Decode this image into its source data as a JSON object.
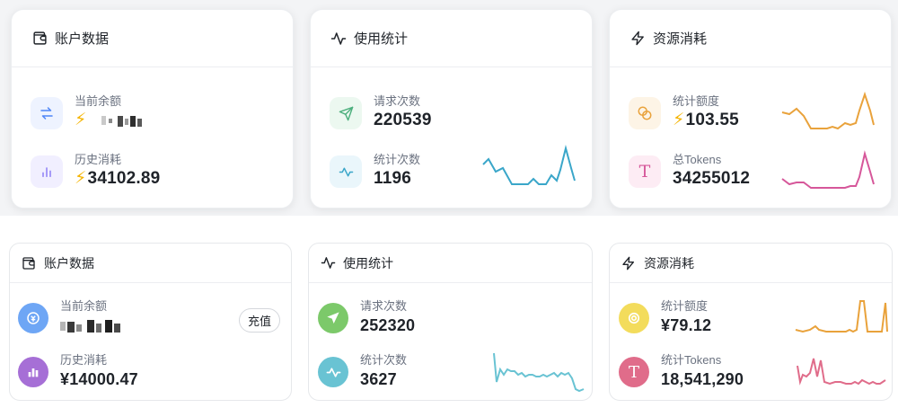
{
  "variant_a": {
    "account": {
      "title": "账户数据",
      "balance_label": "当前余额",
      "history_label": "历史消耗",
      "history_value": "34102.89"
    },
    "usage": {
      "title": "使用统计",
      "requests_label": "请求次数",
      "requests_value": "220539",
      "stat_count_label": "统计次数",
      "stat_count_value": "1196"
    },
    "resource": {
      "title": "资源消耗",
      "quota_label": "统计额度",
      "quota_value": "103.55",
      "tokens_label": "总Tokens",
      "tokens_value": "34255012"
    },
    "colors": {
      "blue": "#4f86f7",
      "purple": "#8b7cf6",
      "green": "#4caf7d",
      "cyan": "#3aa6c9",
      "orange": "#e9a23b",
      "pink": "#d6579a"
    }
  },
  "variant_b": {
    "account": {
      "title": "账户数据",
      "balance_label": "当前余额",
      "recharge_label": "充值",
      "history_label": "历史消耗",
      "history_value": "¥14000.47"
    },
    "usage": {
      "title": "使用统计",
      "requests_label": "请求次数",
      "requests_value": "252320",
      "stat_count_label": "统计次数",
      "stat_count_value": "3627"
    },
    "resource": {
      "title": "资源消耗",
      "quota_label": "统计额度",
      "quota_value": "¥79.12",
      "tokens_label": "统计Tokens",
      "tokens_value": "18,541,290"
    },
    "colors": {
      "blue": "#6ea6f5",
      "purple": "#a66fd6",
      "green": "#7cc96a",
      "cyan": "#69c3d3",
      "yellow": "#f3dc5c",
      "rose": "#e06c8a"
    }
  }
}
